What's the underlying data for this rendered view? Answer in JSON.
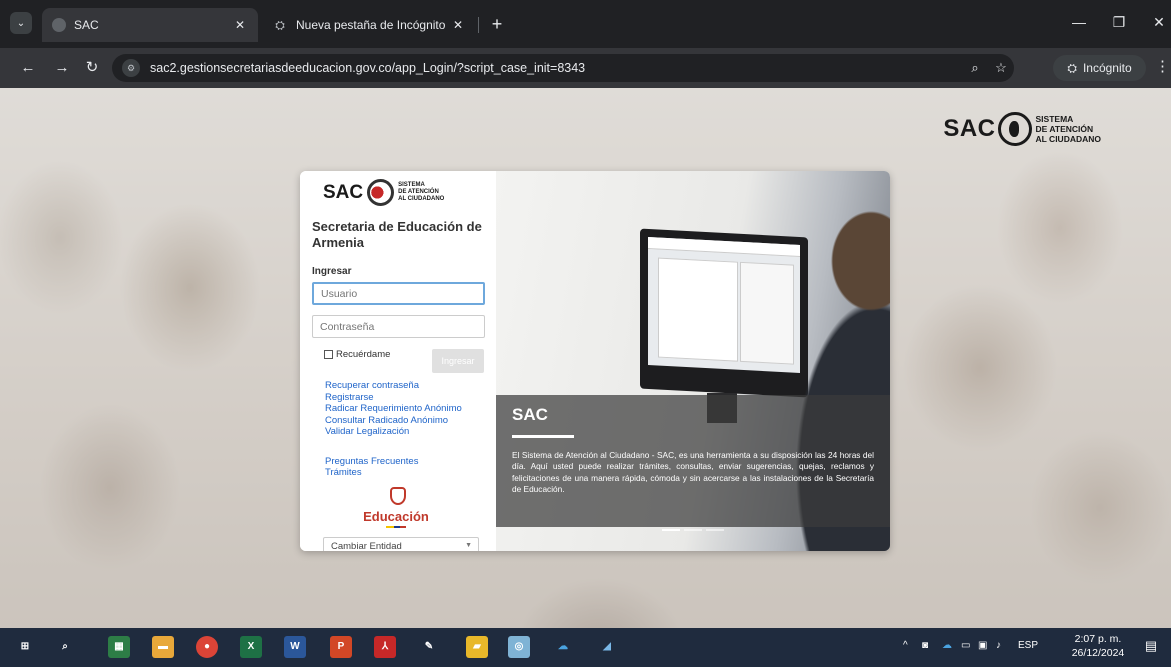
{
  "browser": {
    "tabs": [
      {
        "label": "SAC",
        "active": true
      },
      {
        "label": "Nueva pestaña de Incógnito",
        "active": false
      }
    ],
    "url": "sac2.gestionsecretariasdeeducacion.gov.co/app_Login/?script_case_init=8343",
    "incognito_label": "Incógnito"
  },
  "brand": {
    "name": "SAC",
    "subtitle_line1": "SISTEMA",
    "subtitle_line2": "DE ATENCIÓN",
    "subtitle_line3": "AL CIUDADANO"
  },
  "login": {
    "entity": "Secretaria de Educación de Armenia",
    "section_label": "Ingresar",
    "user_placeholder": "Usuario",
    "password_placeholder": "Contraseña",
    "remember_label": "Recuérdame",
    "submit_label": "Ingresar",
    "links": [
      "Recuperar contraseña",
      "Registrarse",
      "Radicar Requerimiento Anónimo",
      "Consultar Radicado Anónimo",
      "Validar Legalización"
    ],
    "links_secondary": [
      "Preguntas Frecuentes",
      "Trámites"
    ],
    "logo_text": "Educación",
    "entity_select": "Cambiar Entidad"
  },
  "carousel": {
    "title": "SAC",
    "text": "El Sistema de Atención al Ciudadano - SAC, es una herramienta a su disposición las 24 horas del día. Aquí usted puede realizar trámites, consultas, enviar sugerencias, quejas, reclamos y felicitaciones de una manera rápida, cómoda y sin acercarse a las instalaciones de la Secretaría de Educación.",
    "slides": 3,
    "active_slide": 1
  },
  "taskbar": {
    "language": "ESP",
    "time": "2:07 p. m.",
    "date": "26/12/2024"
  }
}
